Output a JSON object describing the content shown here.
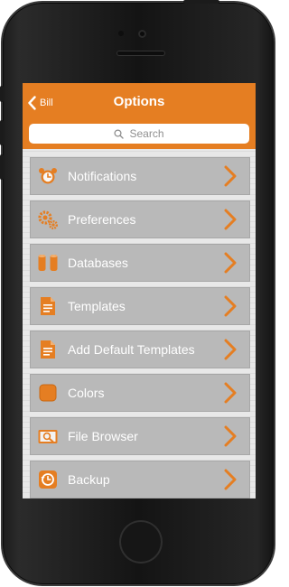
{
  "nav": {
    "back_label": "Bill",
    "title": "Options"
  },
  "search": {
    "placeholder": "Search"
  },
  "menu": {
    "items": [
      {
        "label": "Notifications",
        "icon": "alarm-clock-icon"
      },
      {
        "label": "Preferences",
        "icon": "gears-icon"
      },
      {
        "label": "Databases",
        "icon": "database-icon"
      },
      {
        "label": "Templates",
        "icon": "document-icon"
      },
      {
        "label": "Add Default Templates",
        "icon": "document-add-icon"
      },
      {
        "label": "Colors",
        "icon": "color-swatch-icon"
      },
      {
        "label": "File Browser",
        "icon": "file-browser-icon"
      },
      {
        "label": "Backup",
        "icon": "backup-icon"
      }
    ]
  },
  "colors": {
    "accent": "#e57e22",
    "row_bg": "#b9b9b9",
    "row_text": "#ffffff"
  }
}
